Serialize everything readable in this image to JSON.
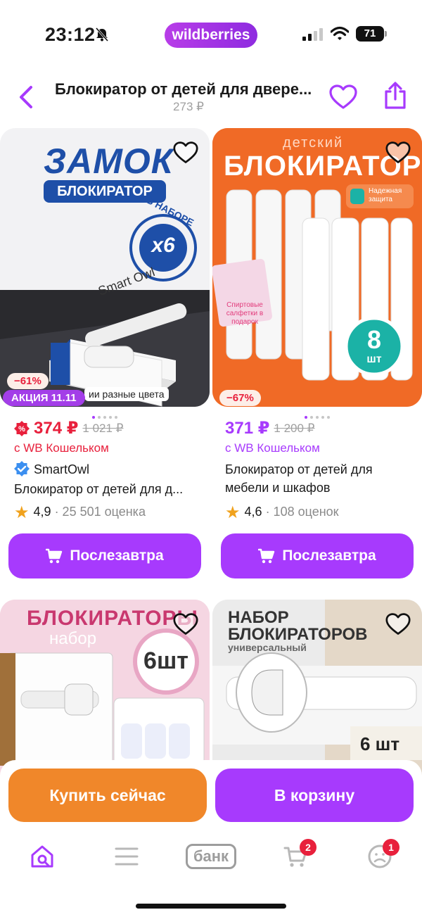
{
  "status_bar": {
    "time": "23:12",
    "app_badge": "wildberries",
    "battery": "71"
  },
  "header": {
    "title": "Блокиратор от детей для двере...",
    "price": "273 ₽"
  },
  "products": [
    {
      "image_headline": "ЗАМОК",
      "image_subline": "БЛОКИРАТОР",
      "image_set": "x6",
      "image_set_label": "В НАБОРЕ",
      "image_box": "Smart Owl",
      "image_caption": "ии разные цвета",
      "discount": "−61%",
      "promo": "АКЦИЯ 11.11",
      "price": "374 ₽",
      "old_price": "1 021 ₽",
      "wallet": "с WB Кошельком",
      "brand": "SmartOwl",
      "name": "Блокиратор от детей для д...",
      "rating": "4,9",
      "reviews": "· 25 501 оценка",
      "delivery": "Послезавтра"
    },
    {
      "image_headline": "детский",
      "image_subline": "БЛОКИРАТОР",
      "image_badge": "Надежная защита",
      "image_gift": "Спиртовые салфетки в подарок",
      "image_count": "8",
      "image_count_unit": "шт",
      "discount": "−67%",
      "price": "371 ₽",
      "old_price": "1 200 ₽",
      "wallet": "с WB Кошельком",
      "name": "Блокиратор от детей для мебели и шкафов",
      "rating": "4,6",
      "reviews": "· 108 оценок",
      "delivery": "Послезавтра"
    },
    {
      "image_headline": "БЛОКИРАТОРЫ",
      "image_subline": "набор",
      "image_count": "6шт"
    },
    {
      "image_headline": "НАБОР БЛОКИРАТОРОВ",
      "image_subline": "универсальный",
      "image_count": "6 шт"
    }
  ],
  "actions": {
    "buy_now": "Купить сейчас",
    "to_cart": "В корзину"
  },
  "tabbar": {
    "bank": "банк",
    "cart_badge": "2",
    "profile_badge": "1"
  },
  "colors": {
    "accent": "#a73afd",
    "sale_red": "#e8203c",
    "buy_orange": "#f0872a"
  }
}
